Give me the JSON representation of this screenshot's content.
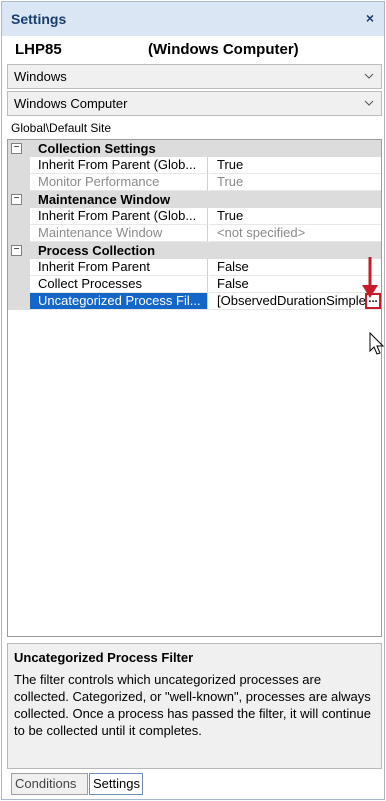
{
  "window": {
    "title": "Settings",
    "close_glyph": "×"
  },
  "header": {
    "name": "LHP85",
    "type": "(Windows Computer)"
  },
  "combo1": {
    "value": "Windows",
    "icon": "chevron-down-icon"
  },
  "combo2": {
    "value": "Windows Computer",
    "icon": "chevron-down-icon"
  },
  "path": "Global\\Default Site",
  "property_grid": {
    "categories": [
      {
        "label": "Collection Settings",
        "toggle": "−",
        "rows": [
          {
            "name": "Inherit From Parent (Glob...",
            "value": "True",
            "dim": false
          },
          {
            "name": "Monitor Performance",
            "value": "True",
            "dim": true
          }
        ]
      },
      {
        "label": "Maintenance Window",
        "toggle": "−",
        "rows": [
          {
            "name": "Inherit From Parent (Glob...",
            "value": "True",
            "dim": false
          },
          {
            "name": "Maintenance Window",
            "value": "<not specified>",
            "dim": true
          }
        ]
      },
      {
        "label": "Process Collection",
        "toggle": "−",
        "rows": [
          {
            "name": "Inherit From Parent",
            "value": "False",
            "dim": false
          },
          {
            "name": "Collect Processes",
            "value": "False",
            "dim": false
          },
          {
            "name": "Uncategorized Process Fil...",
            "value": "[ObservedDurationSimple",
            "dim": false,
            "selected": true
          }
        ]
      }
    ],
    "ellipsis_label": "..."
  },
  "description": {
    "title": "Uncategorized Process Filter",
    "text": "The filter controls which uncategorized processes are collected. Categorized, or \"well-known\", processes are always collected. Once a process has passed the filter, it will continue to be collected until it completes."
  },
  "tabs": [
    {
      "label": "Conditions",
      "active": false
    },
    {
      "label": "Settings",
      "active": true
    }
  ],
  "colors": {
    "accent_selection": "#1466c7",
    "annotation_red": "#c81b2a",
    "title_blue": "#1a3d6e"
  }
}
